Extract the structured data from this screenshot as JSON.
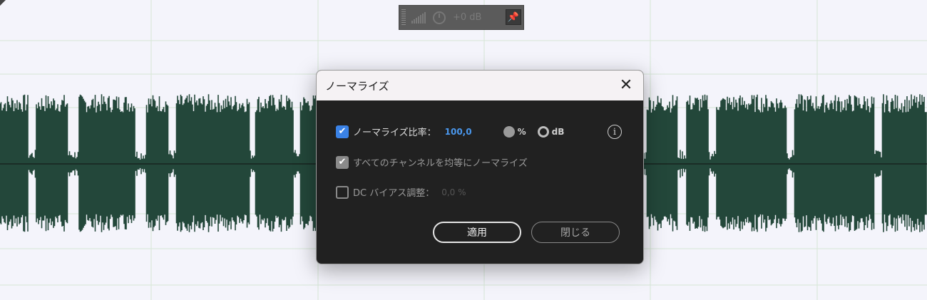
{
  "colors": {
    "background": "#f4f4fb",
    "gridline": "#d6e6d6",
    "waveform": "#23473a",
    "centerline": "#111111",
    "dialog_bg": "#212121",
    "accent_blue": "#3a82e6"
  },
  "hud": {
    "level": "+0 dB",
    "icons": [
      "level-meter-icon",
      "volume-knob-icon",
      "pin-icon"
    ]
  },
  "dialog": {
    "title": "ノーマライズ",
    "close_icon": "close-icon",
    "normalize_ratio": {
      "checked": true,
      "label": "ノーマライズ比率：",
      "value": "100,0",
      "unit_percent": "%",
      "unit_db": "dB"
    },
    "all_channels": {
      "checked": true,
      "label": "すべてのチャンネルを均等にノーマライズ"
    },
    "dc_bias": {
      "checked": false,
      "label": "DC バイアス調整：",
      "value": "0,0 %"
    },
    "info_icon": "info-icon",
    "apply_button": "適用",
    "close_button": "閉じる"
  }
}
